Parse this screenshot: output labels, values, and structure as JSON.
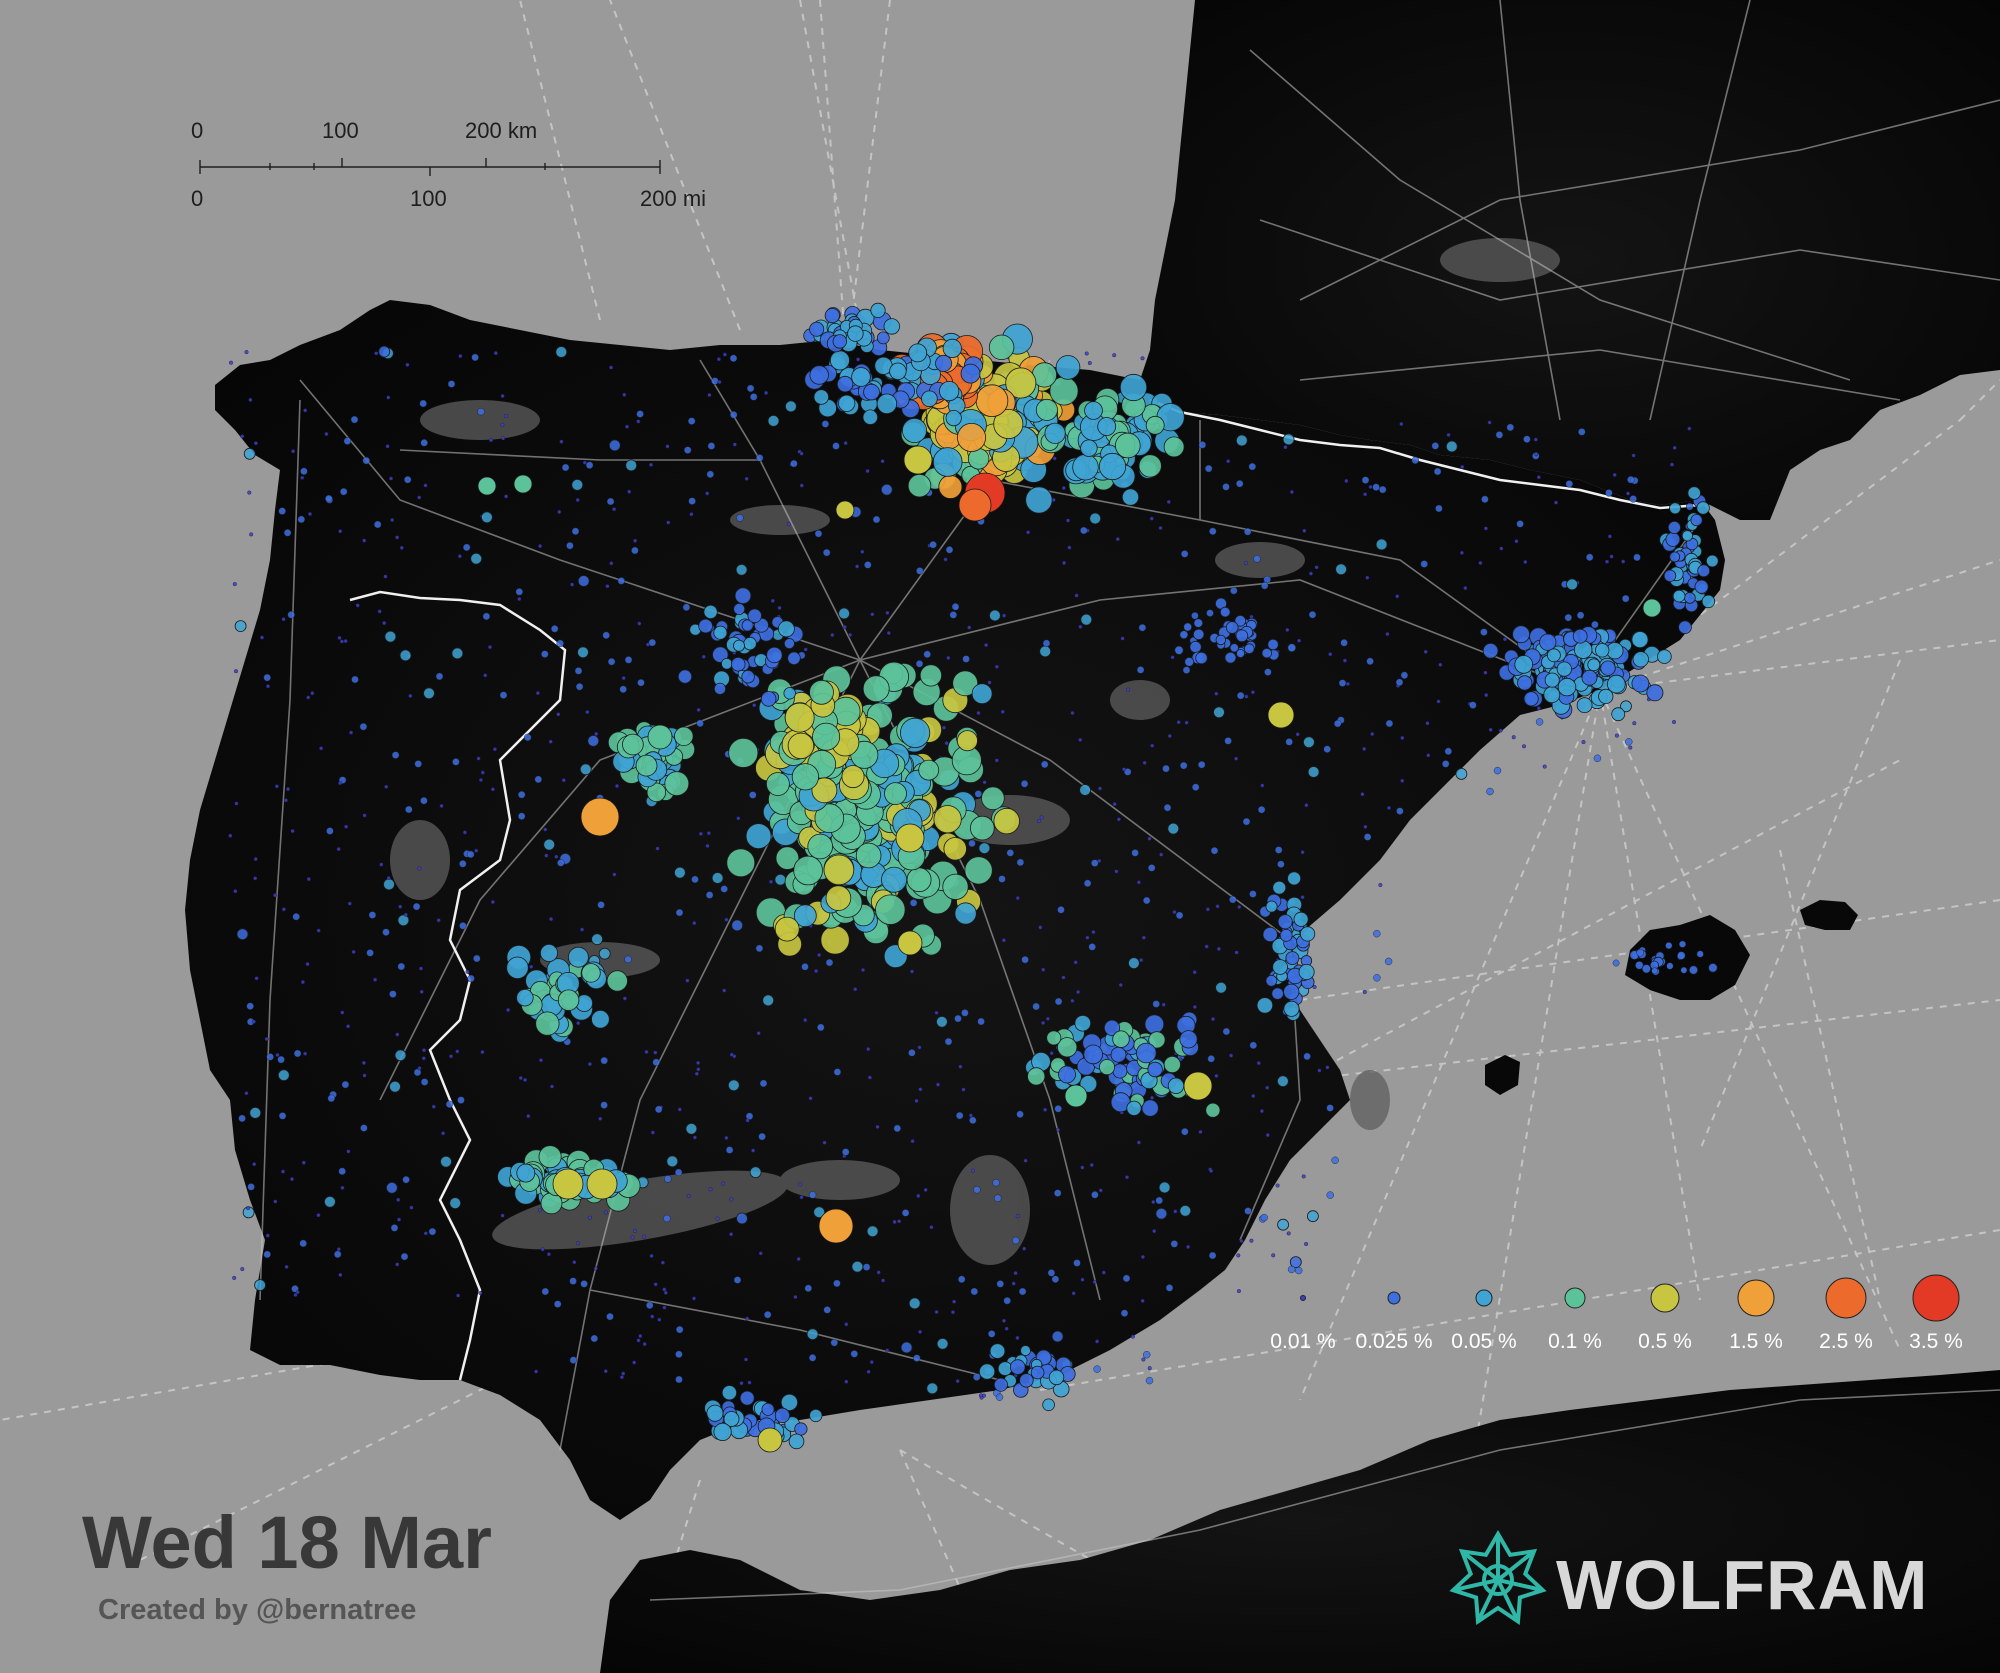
{
  "date_label": "Wed 18 Mar",
  "credit": "Created by @bernatree",
  "brand": {
    "name": "WOLFRAM",
    "logo_icon": "wolfram-spikey-icon",
    "logo_color": "#2fb8a7"
  },
  "scale_bar": {
    "km": {
      "zero": "0",
      "mid": "100",
      "end": "200 km"
    },
    "mi": {
      "zero": "0",
      "mid": "100",
      "end": "200 mi"
    }
  },
  "legend": [
    {
      "label": "0.01 %",
      "color": "#3b3fd6"
    },
    {
      "label": "0.025 %",
      "color": "#3d6fe0"
    },
    {
      "label": "0.05 %",
      "color": "#3fa4d4"
    },
    {
      "label": "0.1 %",
      "color": "#5cc29a"
    },
    {
      "label": "0.5 %",
      "color": "#c8c640"
    },
    {
      "label": "1.5 %",
      "color": "#f0a038"
    },
    {
      "label": "2.5 %",
      "color": "#ec6a2c"
    },
    {
      "label": "3.5 %",
      "color": "#e23a24"
    }
  ],
  "colors": {
    "sea": "#9a9a9a",
    "land": "#080808",
    "roads": "#d0d0d0",
    "border": "#f2f2f2"
  }
}
